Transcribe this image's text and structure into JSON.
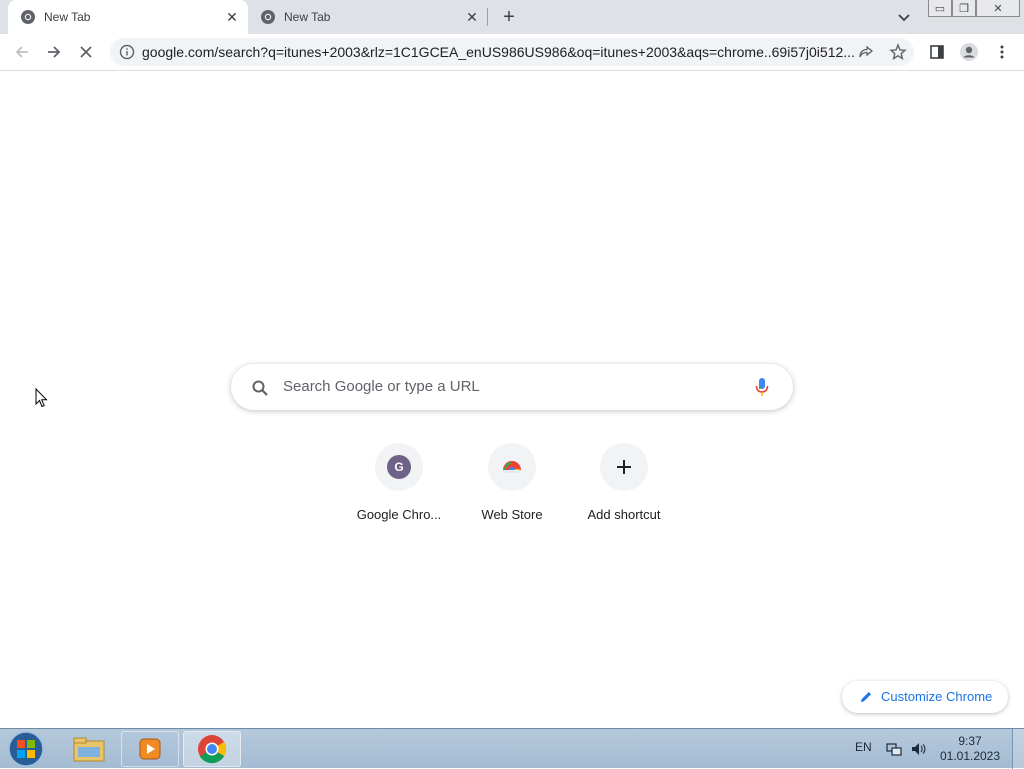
{
  "browser": {
    "tabs": [
      {
        "title": "New Tab",
        "active": true
      },
      {
        "title": "New Tab",
        "active": false
      }
    ],
    "address_bar": {
      "url": "google.com/search?q=itunes+2003&rlz=1C1GCEA_enUS986US986&oq=itunes+2003&aqs=chrome..69i57j0i512..."
    }
  },
  "newtab": {
    "search_placeholder": "Search Google or type a URL",
    "shortcuts": [
      {
        "label": "Google Chro...",
        "badge": "G"
      },
      {
        "label": "Web Store"
      },
      {
        "label": "Add shortcut"
      }
    ],
    "customize_label": "Customize Chrome"
  },
  "taskbar": {
    "language": "EN",
    "time": "9:37",
    "date": "01.01.2023"
  },
  "colors": {
    "accent": "#1a73e8",
    "tabstrip": "#dee1e6",
    "omnibox": "#f1f3f4",
    "taskbar": "#a4bbd2"
  }
}
